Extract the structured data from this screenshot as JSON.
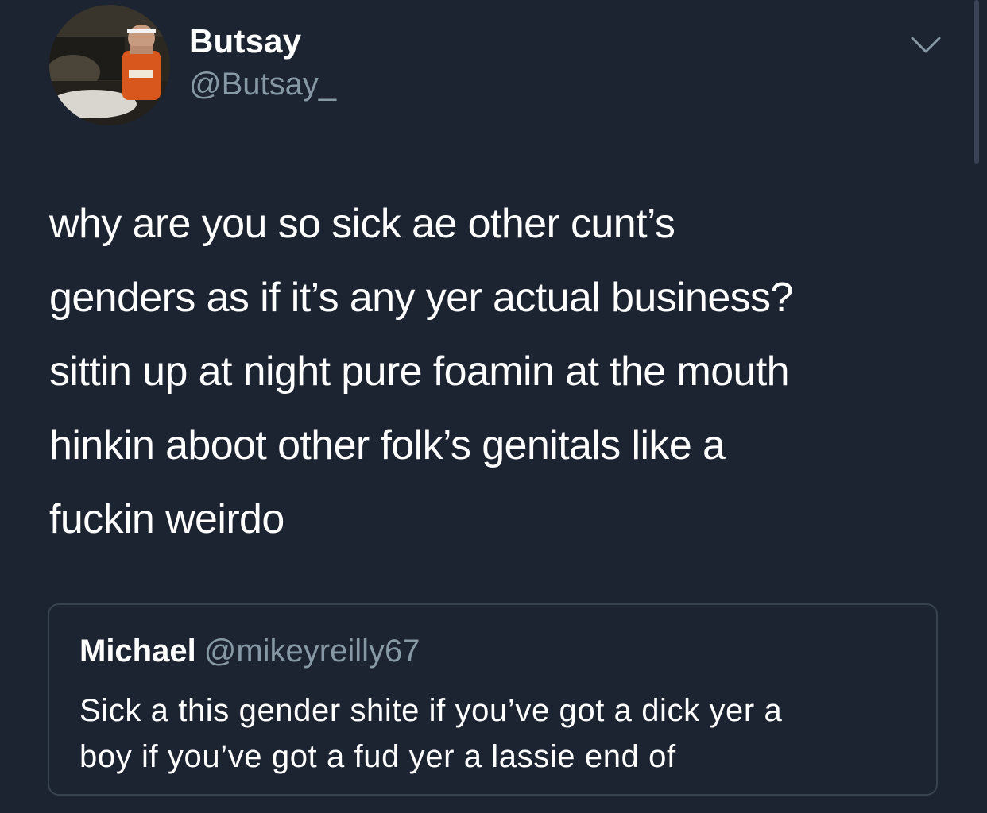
{
  "tweet": {
    "display_name": "Butsay",
    "handle": "@Butsay_",
    "avatar_icon": "profile-photo",
    "menu_icon": "chevron-down-icon",
    "text": "why are you so sick ae other cunt’s\ngenders as if it’s any yer actual business?\nsittin up at night pure foamin at the mouth\nhinkin aboot other folk’s genitals like a\nfuckin weirdo"
  },
  "quoted_tweet": {
    "display_name": "Michael",
    "handle": "@mikeyreilly67",
    "text": "Sick a this gender shite if you’ve got a dick yer a\nboy if you’ve got a fud yer a lassie end of"
  },
  "colors": {
    "background": "#1c2331",
    "secondary_text": "#8899a6",
    "border": "#38444d"
  }
}
